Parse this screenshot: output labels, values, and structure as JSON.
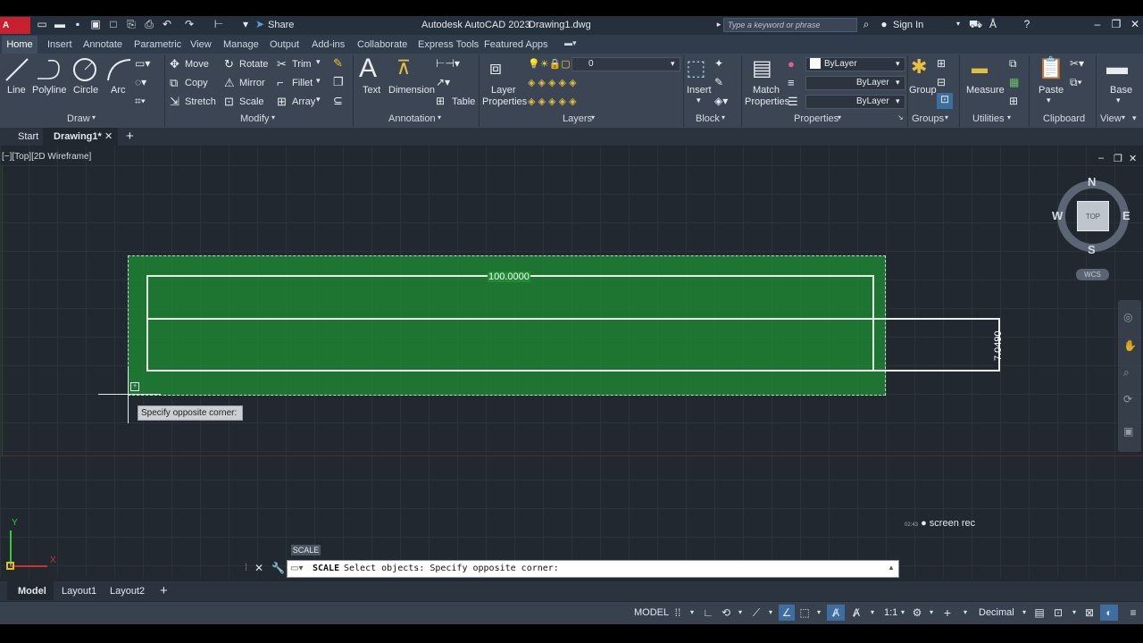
{
  "app": {
    "logo": "A CAD",
    "title": "Autodesk AutoCAD 2023",
    "file": "Drawing1.dwg",
    "share": "Share",
    "search_placeholder": "Type a keyword or phrase",
    "sign_in": "Sign In"
  },
  "menu_tabs": [
    "Home",
    "Insert",
    "Annotate",
    "Parametric",
    "View",
    "Manage",
    "Output",
    "Add-ins",
    "Collaborate",
    "Express Tools",
    "Featured Apps"
  ],
  "ribbon": {
    "draw": {
      "label": "Draw",
      "line": "Line",
      "polyline": "Polyline",
      "circle": "Circle",
      "arc": "Arc"
    },
    "modify": {
      "label": "Modify",
      "move": "Move",
      "rotate": "Rotate",
      "trim": "Trim",
      "copy": "Copy",
      "mirror": "Mirror",
      "fillet": "Fillet",
      "stretch": "Stretch",
      "scale": "Scale",
      "array": "Array"
    },
    "annotation": {
      "label": "Annotation",
      "text": "Text",
      "dimension": "Dimension",
      "table": "Table"
    },
    "layers": {
      "label": "Layers",
      "layer_properties_1": "Layer",
      "layer_properties_2": "Properties",
      "current_layer": "0"
    },
    "block": {
      "label": "Block",
      "insert": "Insert"
    },
    "properties": {
      "label": "Properties",
      "match_1": "Match",
      "match_2": "Properties",
      "color": "ByLayer",
      "linetype": "ByLayer",
      "lineweight": "ByLayer"
    },
    "groups": {
      "label": "Groups",
      "group": "Group"
    },
    "utilities": {
      "label": "Utilities",
      "measure": "Measure"
    },
    "clipboard": {
      "label": "Clipboard",
      "paste": "Paste"
    },
    "view": {
      "label": "View",
      "base": "Base"
    }
  },
  "file_tabs": {
    "start": "Start",
    "drawing": "Drawing1*"
  },
  "viewport": {
    "label": "[−][Top][2D Wireframe]",
    "dim_horizontal": "100.0000",
    "dim_vertical": "7.0490",
    "tooltip": "Specify opposite corner:"
  },
  "navcube": {
    "n": "N",
    "s": "S",
    "e": "E",
    "w": "W",
    "top": "TOP",
    "wcs": "WCS"
  },
  "command": {
    "hint": "SCALE",
    "name": "SCALE",
    "text": "Select objects: Specify opposite corner:"
  },
  "layout_tabs": [
    "Model",
    "Layout1",
    "Layout2"
  ],
  "status": {
    "model": "MODEL",
    "scale": "1:1",
    "units": "Decimal"
  },
  "watermark": {
    "time": "02:43",
    "brand": "screen rec"
  }
}
